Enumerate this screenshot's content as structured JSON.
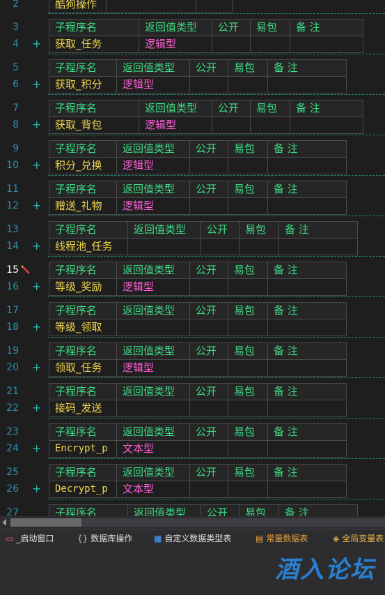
{
  "header": {
    "name_label": "子程序名",
    "return_type_label": "返回值类型",
    "public_label": "公开",
    "easy_pack_label": "易包",
    "remark_label": "备 注"
  },
  "top_partial": {
    "line": "2",
    "name": "酷狗操作"
  },
  "subroutines": [
    {
      "hdr_line": "3",
      "row_line": "4",
      "name": "获取_任务",
      "type": "逻辑型"
    },
    {
      "hdr_line": "5",
      "row_line": "6",
      "name": "获取_积分",
      "type": "逻辑型"
    },
    {
      "hdr_line": "7",
      "row_line": "8",
      "name": "获取_背包",
      "type": "逻辑型"
    },
    {
      "hdr_line": "9",
      "row_line": "10",
      "name": "积分_兑换",
      "type": "逻辑型"
    },
    {
      "hdr_line": "11",
      "row_line": "12",
      "name": "赠送_礼物",
      "type": "逻辑型"
    },
    {
      "hdr_line": "13",
      "row_line": "14",
      "name": "线程池_任务",
      "type": ""
    },
    {
      "hdr_line": "15",
      "row_line": "16",
      "name": "等级_奖励",
      "type": "逻辑型"
    },
    {
      "hdr_line": "17",
      "row_line": "18",
      "name": "等级_领取",
      "type": ""
    },
    {
      "hdr_line": "19",
      "row_line": "20",
      "name": "领取_任务",
      "type": "逻辑型"
    },
    {
      "hdr_line": "21",
      "row_line": "22",
      "name": "接码_发送",
      "type": ""
    },
    {
      "hdr_line": "23",
      "row_line": "24",
      "name": "Encrypt_p",
      "type": "文本型"
    },
    {
      "hdr_line": "25",
      "row_line": "26",
      "name": "Decrypt_p",
      "type": "文本型"
    },
    {
      "hdr_line": "27",
      "row_line": "",
      "name": "",
      "type": ""
    }
  ],
  "current_line": "15",
  "expand_symbol": "+",
  "tabs": [
    {
      "label": "_启动窗口",
      "icon": "window-icon"
    },
    {
      "label": "数据库操作",
      "icon": "braces-icon"
    },
    {
      "label": "自定义数据类型表",
      "icon": "grid-icon"
    },
    {
      "label": "常量数据表",
      "icon": "table-icon"
    },
    {
      "label": "全局变量表",
      "icon": "global-icon"
    }
  ],
  "watermark": "酒入论坛",
  "colors": {
    "header_text": "#3ddc84",
    "name_text": "#f0d64e",
    "type_text": "#ff5fd7",
    "line_number": "#2b91af",
    "separator": "#1f8c6e",
    "watermark": "#2a7fd1"
  }
}
